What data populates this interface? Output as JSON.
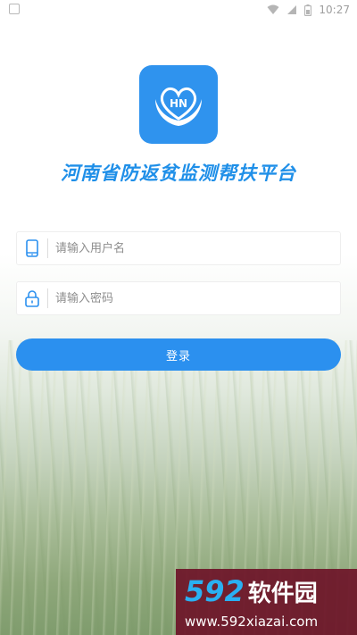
{
  "status_bar": {
    "time": "10:27"
  },
  "app": {
    "logo_text": "HN",
    "title": "河南省防返贫监测帮扶平台"
  },
  "login_form": {
    "username_placeholder": "请输入用户名",
    "password_placeholder": "请输入密码",
    "login_label": "登录"
  },
  "watermark": {
    "number": "592",
    "name": "软件园",
    "url": "www.592xiazai.com"
  },
  "colors": {
    "accent": "#2b90ef",
    "title": "#1f8fe8",
    "watermark_bg": "#6e1428"
  }
}
